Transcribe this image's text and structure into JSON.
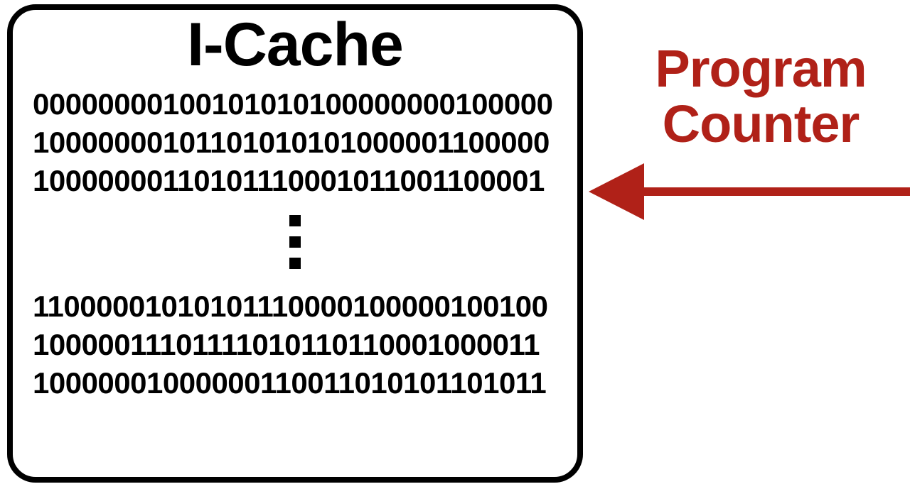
{
  "icache": {
    "title": "I-Cache",
    "lines_top": [
      "00000000100101010100000000100000",
      "10000000101101010101000001100000",
      "10000000110101110001011001100001"
    ],
    "lines_bottom": [
      "11000001010101110000100000100100",
      "10000011101111010110110001000011",
      "10000001000000110011010101101011"
    ]
  },
  "pointer": {
    "label_line1": "Program",
    "label_line2": "Counter",
    "color": "#b02118"
  }
}
